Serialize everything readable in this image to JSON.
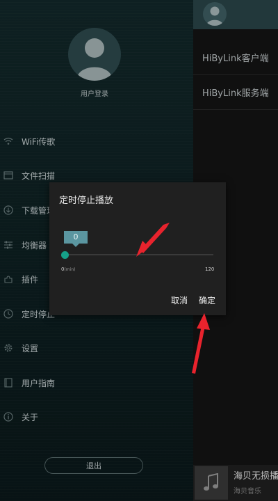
{
  "drawer": {
    "login_label": "用户登录",
    "menu": [
      {
        "label": "WiFi传歌",
        "icon": "wifi-icon"
      },
      {
        "label": "文件扫描",
        "icon": "folder-scan-icon"
      },
      {
        "label": "下载管理",
        "icon": "download-icon"
      },
      {
        "label": "均衡器",
        "icon": "equalizer-icon"
      },
      {
        "label": "插件",
        "icon": "plugin-icon"
      },
      {
        "label": "定时停止",
        "icon": "timer-icon"
      },
      {
        "label": "设置",
        "icon": "gear-icon"
      },
      {
        "label": "用户指南",
        "icon": "guide-book-icon"
      },
      {
        "label": "关于",
        "icon": "info-icon"
      }
    ],
    "logout_label": "退出"
  },
  "background_panel": {
    "items": [
      "HiByLink客户端",
      "HiByLink服务端"
    ],
    "player": {
      "title": "海贝无损播放",
      "subtitle": "海贝音乐",
      "icon": "music-note-icon"
    }
  },
  "dialog": {
    "title": "定时停止播放",
    "slider": {
      "value": "0",
      "fraction": 0,
      "min_label": "0",
      "min_unit": "(min)",
      "max_label": "120"
    },
    "cancel_label": "取消",
    "ok_label": "确定"
  },
  "colors": {
    "accent": "#16a088",
    "bubble": "#5b96a0",
    "arrow": "#e8232d"
  }
}
